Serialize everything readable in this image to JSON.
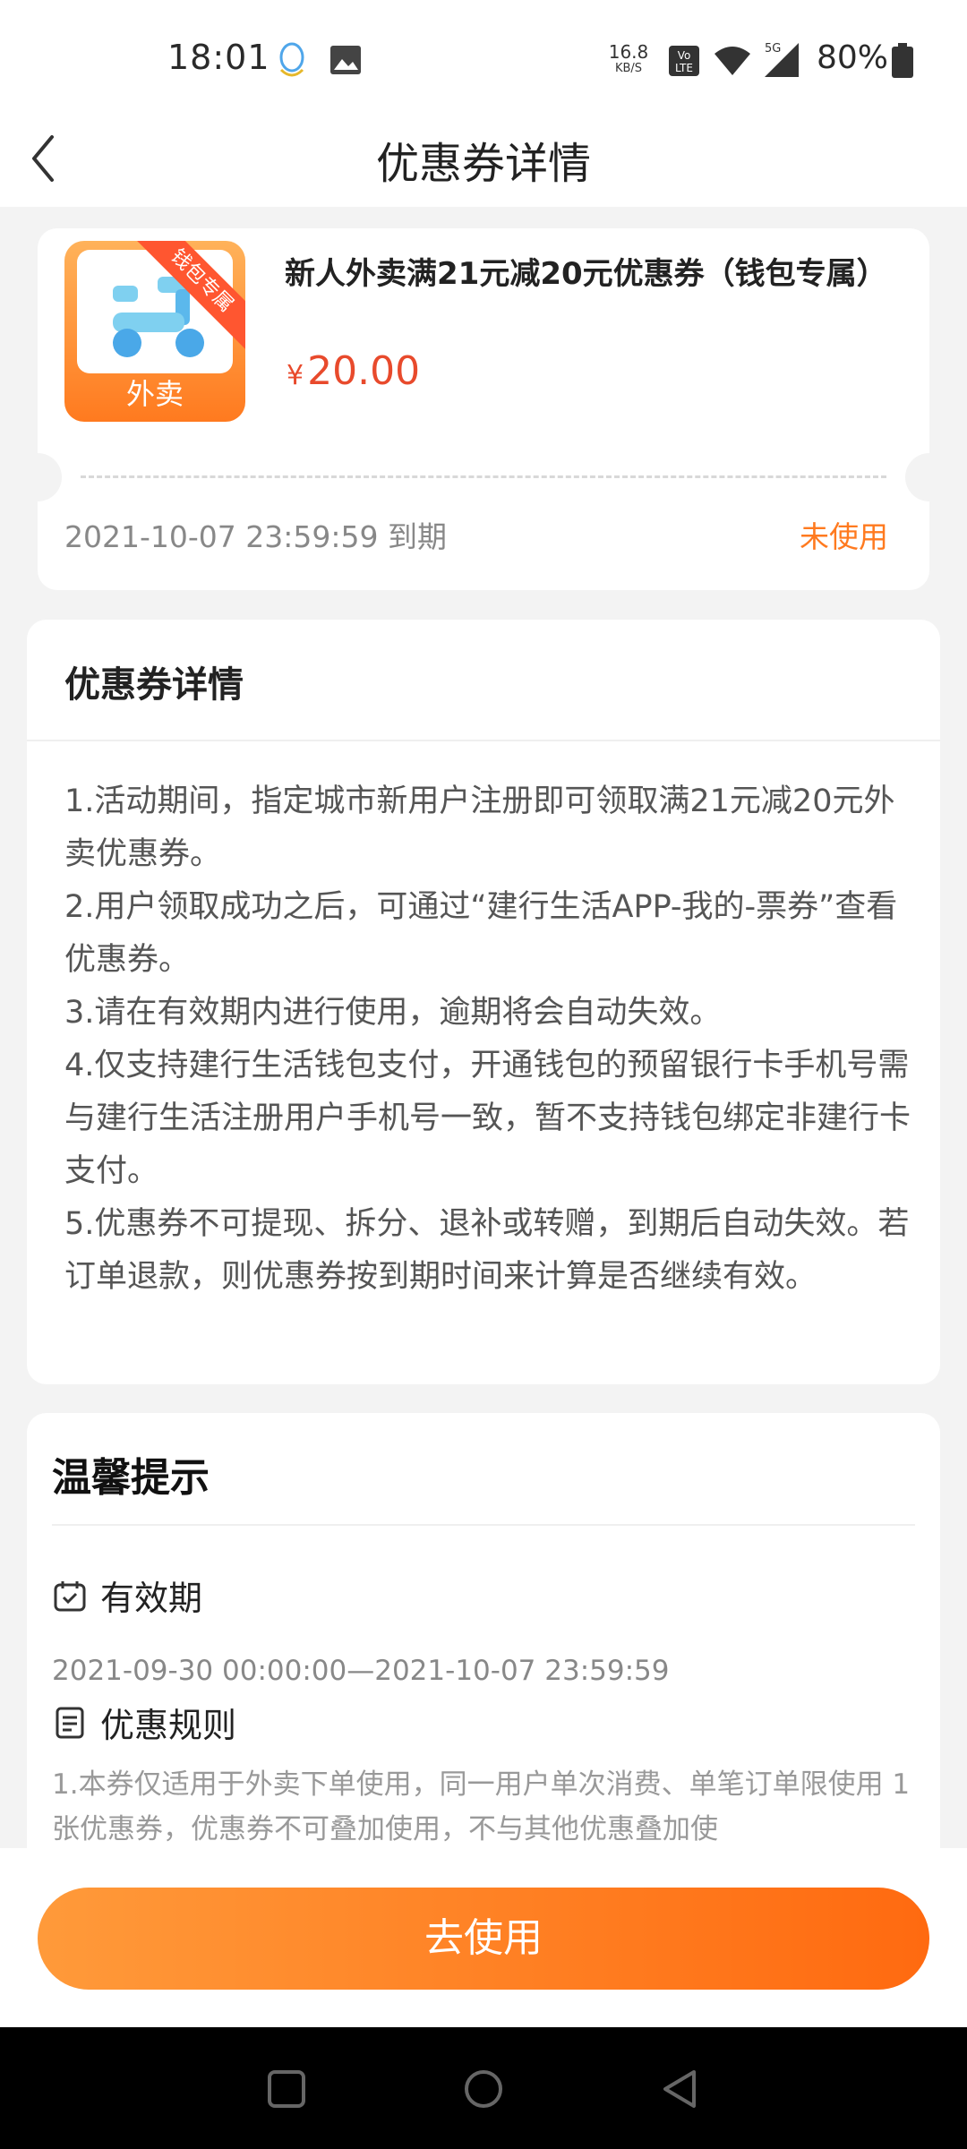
{
  "status_bar": {
    "time": "18:01",
    "net_speed_value": "16.8",
    "net_speed_unit": "KB/S",
    "volte": "VoLTE",
    "signal": "5G",
    "battery": "80%"
  },
  "header": {
    "title": "优惠券详情"
  },
  "coupon": {
    "thumb_label": "外卖",
    "thumb_ribbon": "钱包专属",
    "title": "新人外卖满21元减20元优惠券（钱包专属）",
    "currency": "¥",
    "price": "20.00",
    "expiry": "2021-10-07 23:59:59 到期",
    "status": "未使用"
  },
  "details": {
    "title": "优惠券详情",
    "items": [
      "1.活动期间，指定城市新用户注册即可领取满21元减20元外卖优惠券。",
      "2.用户领取成功之后，可通过“建行生活APP-我的-票券”查看优惠券。",
      "3.请在有效期内进行使用，逾期将会自动失效。",
      "4.仅支持建行生活钱包支付，开通钱包的预留银行卡手机号需与建行生活注册用户手机号一致，暂不支持钱包绑定非建行卡支付。",
      "5.优惠券不可提现、拆分、退补或转赠，到期后自动失效。若订单退款，则优惠券按到期时间来计算是否继续有效。"
    ]
  },
  "tips": {
    "title": "温馨提示",
    "validity_label": "有效期",
    "validity_value": "2021-09-30 00:00:00—2021-10-07 23:59:59",
    "rules_label": "优惠规则",
    "rules_text": "1.本券仅适用于外卖下单使用，同一用户单次消费、单笔订单限使用 1 张优惠券，优惠券不可叠加使用，不与其他优惠叠加使"
  },
  "action": {
    "use_label": "去使用"
  },
  "colors": {
    "accent": "#ff7a1f",
    "price": "#e84a2c"
  }
}
